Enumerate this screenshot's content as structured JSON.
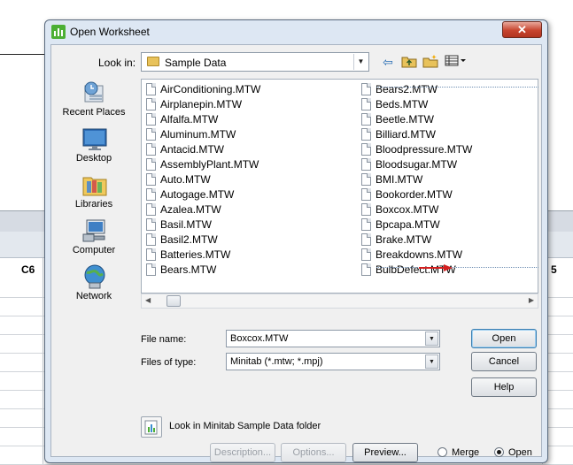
{
  "background": {
    "col_left": "C6",
    "col_right": "5"
  },
  "dialog": {
    "title": "Open Worksheet",
    "close_glyph": "✕"
  },
  "look_in": {
    "label": "Look in:",
    "value": "Sample Data"
  },
  "places": [
    {
      "label": "Recent Places",
      "icon": "recent-places-icon"
    },
    {
      "label": "Desktop",
      "icon": "desktop-icon"
    },
    {
      "label": "Libraries",
      "icon": "libraries-icon"
    },
    {
      "label": "Computer",
      "icon": "computer-icon"
    },
    {
      "label": "Network",
      "icon": "network-icon"
    }
  ],
  "files": {
    "column1": [
      "AirConditioning.MTW",
      "Airplanepin.MTW",
      "Alfalfa.MTW",
      "Aluminum.MTW",
      "Antacid.MTW",
      "AssemblyPlant.MTW",
      "Auto.MTW",
      "Autogage.MTW",
      "Azalea.MTW",
      "Basil.MTW",
      "Basil2.MTW",
      "Batteries.MTW",
      "Bears.MTW"
    ],
    "column2": [
      "Bears2.MTW",
      "Beds.MTW",
      "Beetle.MTW",
      "Billiard.MTW",
      "Bloodpressure.MTW",
      "Bloodsugar.MTW",
      "BMI.MTW",
      "Bookorder.MTW",
      "Boxcox.MTW",
      "Bpcapa.MTW",
      "Brake.MTW",
      "Breakdowns.MTW",
      "BulbDefect.MTW"
    ],
    "selected": "Boxcox.MTW"
  },
  "file_name": {
    "label": "File name:",
    "value": "Boxcox.MTW"
  },
  "file_type": {
    "label": "Files of type:",
    "value": "Minitab (*.mtw; *.mpj)"
  },
  "buttons": {
    "open": "Open",
    "cancel": "Cancel",
    "help": "Help",
    "description": "Description...",
    "options": "Options...",
    "preview": "Preview..."
  },
  "sample_folder_label": "Look in Minitab Sample Data folder",
  "mode": {
    "merge": "Merge",
    "open": "Open",
    "selected": "open"
  },
  "colors": {
    "dialog_frame": "#dde7f3",
    "close_button": "#c7452f",
    "arrow": "#d42020",
    "default_button_border": "#3c7fb1"
  }
}
